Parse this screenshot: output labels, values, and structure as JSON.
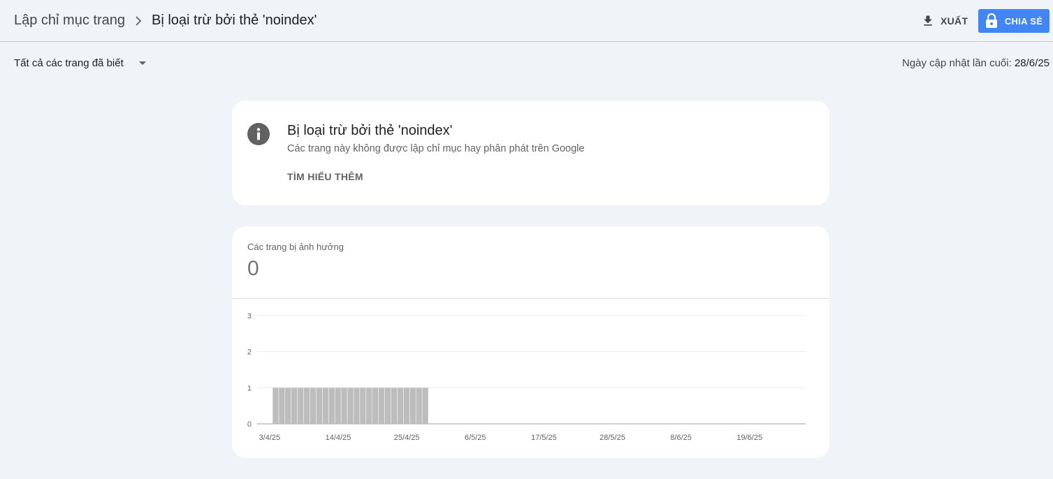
{
  "header": {
    "breadcrumb_parent": "Lập chỉ mục trang",
    "breadcrumb_current": "Bị loại trừ bởi thẻ 'noindex'",
    "export_label": "XUẤT",
    "share_label": "CHIA SẺ",
    "share_color": "#4285f4"
  },
  "filter": {
    "selected": "Tất cả các trang đã biết",
    "last_updated_label": "Ngày cập nhật lần cuối:",
    "last_updated_value": "28/6/25"
  },
  "info_card": {
    "icon": "info-icon",
    "title": "Bị loại trừ bởi thẻ 'noindex'",
    "description": "Các trang này không được lập chỉ mục hay phân phát trên Google",
    "learn_more": "TÌM HIỂU THÊM"
  },
  "metric": {
    "label": "Các trang bị ảnh hưởng",
    "value": "0"
  },
  "chart_data": {
    "type": "bar",
    "title": "",
    "xlabel": "",
    "ylabel": "",
    "ylim": [
      0,
      3
    ],
    "y_ticks": [
      0,
      1,
      2,
      3
    ],
    "x_range": [
      "2025-04-01",
      "2025-06-28"
    ],
    "x_tick_dates": [
      "2025-04-03",
      "2025-04-14",
      "2025-04-25",
      "2025-05-06",
      "2025-05-17",
      "2025-05-28",
      "2025-06-08",
      "2025-06-19"
    ],
    "x_tick_labels": [
      "3/4/25",
      "14/4/25",
      "25/4/25",
      "6/5/25",
      "17/5/25",
      "28/5/25",
      "8/6/25",
      "19/6/25"
    ],
    "bar_color": "#bdbdbd",
    "grid": true,
    "series": [
      {
        "points": [
          {
            "x": "2025-04-04",
            "y": 1
          },
          {
            "x": "2025-04-05",
            "y": 1
          },
          {
            "x": "2025-04-06",
            "y": 1
          },
          {
            "x": "2025-04-07",
            "y": 1
          },
          {
            "x": "2025-04-08",
            "y": 1
          },
          {
            "x": "2025-04-09",
            "y": 1
          },
          {
            "x": "2025-04-10",
            "y": 1
          },
          {
            "x": "2025-04-11",
            "y": 1
          },
          {
            "x": "2025-04-12",
            "y": 1
          },
          {
            "x": "2025-04-13",
            "y": 1
          },
          {
            "x": "2025-04-14",
            "y": 1
          },
          {
            "x": "2025-04-15",
            "y": 1
          },
          {
            "x": "2025-04-16",
            "y": 1
          },
          {
            "x": "2025-04-17",
            "y": 1
          },
          {
            "x": "2025-04-18",
            "y": 1
          },
          {
            "x": "2025-04-19",
            "y": 1
          },
          {
            "x": "2025-04-20",
            "y": 1
          },
          {
            "x": "2025-04-21",
            "y": 1
          },
          {
            "x": "2025-04-22",
            "y": 1
          },
          {
            "x": "2025-04-23",
            "y": 1
          },
          {
            "x": "2025-04-24",
            "y": 1
          },
          {
            "x": "2025-04-25",
            "y": 1
          },
          {
            "x": "2025-04-26",
            "y": 1
          },
          {
            "x": "2025-04-27",
            "y": 1
          },
          {
            "x": "2025-04-28",
            "y": 1
          }
        ]
      }
    ]
  }
}
